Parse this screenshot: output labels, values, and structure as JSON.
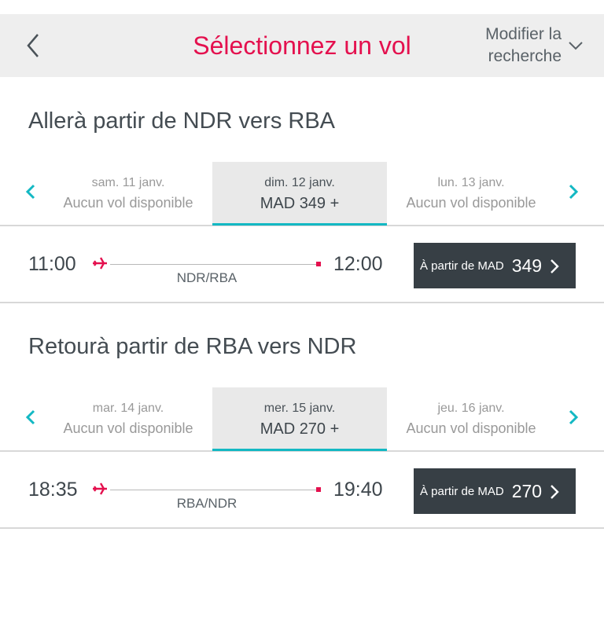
{
  "header": {
    "title": "Sélectionnez un vol",
    "modify_line1": "Modifier la",
    "modify_line2": "recherche"
  },
  "outbound": {
    "title": "Allerà partir de NDR vers RBA",
    "dates": [
      {
        "date": "sam. 11 janv.",
        "status": "Aucun vol disponible"
      },
      {
        "date": "dim. 12 janv.",
        "status": "MAD 349 +"
      },
      {
        "date": "lun. 13 janv.",
        "status": "Aucun vol disponible"
      }
    ],
    "flight": {
      "depart": "11:00",
      "arrive": "12:00",
      "route": "NDR/RBA",
      "price_label": "À partir de MAD",
      "price": "349"
    }
  },
  "return": {
    "title": "Retourà partir de RBA vers NDR",
    "dates": [
      {
        "date": "mar. 14 janv.",
        "status": "Aucun vol disponible"
      },
      {
        "date": "mer. 15 janv.",
        "status": "MAD 270 +"
      },
      {
        "date": "jeu. 16 janv.",
        "status": "Aucun vol disponible"
      }
    ],
    "flight": {
      "depart": "18:35",
      "arrive": "19:40",
      "route": "RBA/NDR",
      "price_label": "À partir de MAD",
      "price": "270"
    }
  },
  "colors": {
    "accent": "#e4104e",
    "teal": "#13b8c3",
    "dark_button": "#373f45"
  }
}
